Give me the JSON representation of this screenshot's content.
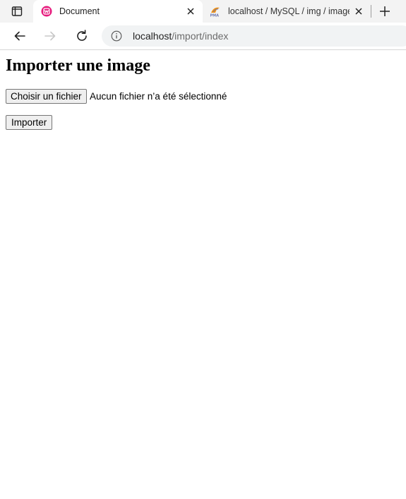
{
  "browser": {
    "tabs": [
      {
        "title": "Document",
        "active": true,
        "favicon": "wamp-icon"
      },
      {
        "title": "localhost / MySQL / img / image",
        "active": false,
        "favicon": "phpmyadmin-icon"
      }
    ],
    "address": {
      "host": "localhost",
      "path": "/import/index"
    }
  },
  "page": {
    "heading": "Importer une image",
    "file_input": {
      "button_label": "Choisir un fichier",
      "status": "Aucun fichier n’a été sélectionné"
    },
    "submit_label": "Importer"
  },
  "colors": {
    "accent_favicon": "#e6197c",
    "tabstrip_bg": "#f3f3f3",
    "omnibox_bg": "#f1f3f4"
  }
}
